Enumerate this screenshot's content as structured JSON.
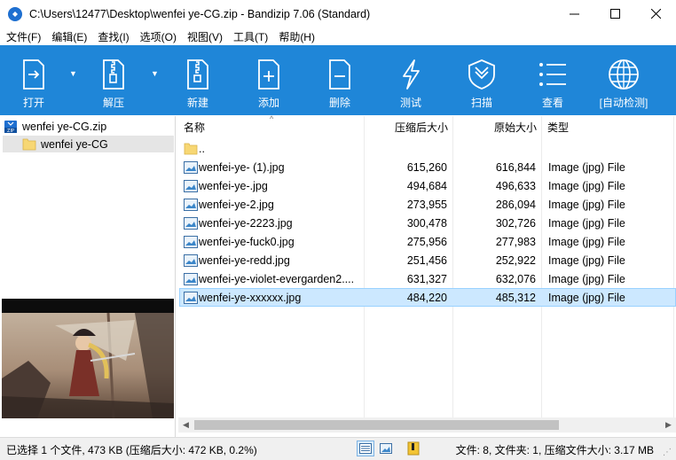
{
  "window": {
    "title": "C:\\Users\\12477\\Desktop\\wenfei ye-CG.zip - Bandizip 7.06 (Standard)",
    "app_icon": "bandizip-icon",
    "controls": [
      "minimize-icon",
      "maximize-icon",
      "close-icon"
    ]
  },
  "menu": [
    {
      "label": "文件(F)"
    },
    {
      "label": "编辑(E)"
    },
    {
      "label": "查找(I)"
    },
    {
      "label": "选项(O)"
    },
    {
      "label": "视图(V)"
    },
    {
      "label": "工具(T)"
    },
    {
      "label": "帮助(H)"
    }
  ],
  "toolbar": {
    "background": "#1f86d8",
    "buttons": [
      {
        "label": "打开",
        "icon": "open-icon",
        "has_dropdown": true
      },
      {
        "label": "解压",
        "icon": "extract-icon",
        "has_dropdown": true
      },
      {
        "label": "新建",
        "icon": "new-archive-icon"
      },
      {
        "label": "添加",
        "icon": "add-file-icon"
      },
      {
        "label": "删除",
        "icon": "delete-file-icon"
      },
      {
        "label": "测试",
        "icon": "test-lightning-icon"
      },
      {
        "label": "扫描",
        "icon": "scan-shield-icon"
      },
      {
        "label": "查看",
        "icon": "view-list-icon"
      },
      {
        "label": "[自动检测]",
        "icon": "codepage-globe-icon"
      }
    ]
  },
  "tree": {
    "root": {
      "label": "wenfei ye-CG.zip",
      "icon": "zip-file-icon"
    },
    "child": {
      "label": "wenfei ye-CG",
      "icon": "folder-icon",
      "selected": true
    }
  },
  "columns": {
    "name": "名称",
    "packed": "压缩后大小",
    "original": "原始大小",
    "type": "类型"
  },
  "files": [
    {
      "name": "..",
      "packed": "",
      "original": "",
      "type": "",
      "icon": "folder-icon"
    },
    {
      "name": "wenfei-ye- (1).jpg",
      "packed": "615,260",
      "original": "616,844",
      "type": "Image (jpg) File",
      "icon": "image-file-icon"
    },
    {
      "name": "wenfei-ye-.jpg",
      "packed": "494,684",
      "original": "496,633",
      "type": "Image (jpg) File",
      "icon": "image-file-icon"
    },
    {
      "name": "wenfei-ye-2.jpg",
      "packed": "273,955",
      "original": "286,094",
      "type": "Image (jpg) File",
      "icon": "image-file-icon"
    },
    {
      "name": "wenfei-ye-2223.jpg",
      "packed": "300,478",
      "original": "302,726",
      "type": "Image (jpg) File",
      "icon": "image-file-icon"
    },
    {
      "name": "wenfei-ye-fuck0.jpg",
      "packed": "275,956",
      "original": "277,983",
      "type": "Image (jpg) File",
      "icon": "image-file-icon"
    },
    {
      "name": "wenfei-ye-redd.jpg",
      "packed": "251,456",
      "original": "252,922",
      "type": "Image (jpg) File",
      "icon": "image-file-icon"
    },
    {
      "name": "wenfei-ye-violet-evergarden2....",
      "packed": "631,327",
      "original": "632,076",
      "type": "Image (jpg) File",
      "icon": "image-file-icon"
    },
    {
      "name": "wenfei-ye-xxxxxx.jpg",
      "packed": "484,220",
      "original": "485,312",
      "type": "Image (jpg) File",
      "icon": "image-file-icon",
      "selected": true
    }
  ],
  "status": {
    "left": "已选择 1 个文件, 473 KB (压缩后大小: 472 KB, 0.2%)",
    "right": "文件: 8, 文件夹: 1, 压缩文件大小: 3.17 MB",
    "view_icons": [
      "details-view-icon",
      "thumbnail-view-icon",
      "archive-info-icon"
    ]
  }
}
